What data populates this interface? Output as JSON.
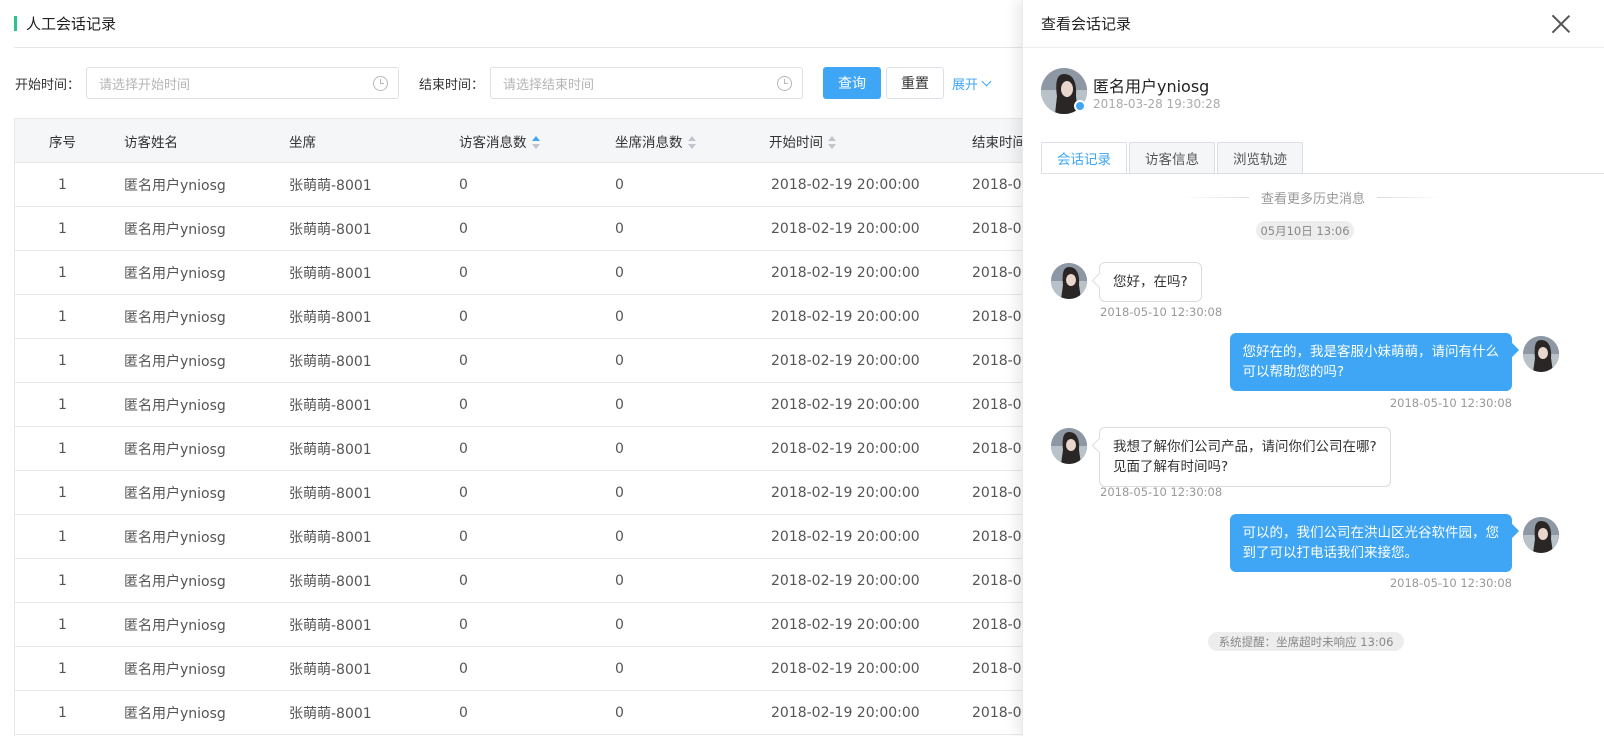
{
  "page": {
    "title": "人工会话记录",
    "filters": {
      "start_label": "开始时间：",
      "start_placeholder": "请选择开始时间",
      "end_label": "结束时间：",
      "end_placeholder": "请选择结束时间",
      "query_label": "查询",
      "reset_label": "重置",
      "expand_label": "展开"
    },
    "table": {
      "columns": [
        "序号",
        "访客姓名",
        "坐席",
        "访客消息数",
        "坐席消息数",
        "开始时间",
        "结束时间"
      ],
      "rows": [
        [
          "1",
          "匿名用户yniosg",
          "张萌萌-8001",
          "0",
          "0",
          "2018-02-19 20:00:00",
          "2018-0"
        ],
        [
          "1",
          "匿名用户yniosg",
          "张萌萌-8001",
          "0",
          "0",
          "2018-02-19 20:00:00",
          "2018-0"
        ],
        [
          "1",
          "匿名用户yniosg",
          "张萌萌-8001",
          "0",
          "0",
          "2018-02-19 20:00:00",
          "2018-0"
        ],
        [
          "1",
          "匿名用户yniosg",
          "张萌萌-8001",
          "0",
          "0",
          "2018-02-19 20:00:00",
          "2018-0"
        ],
        [
          "1",
          "匿名用户yniosg",
          "张萌萌-8001",
          "0",
          "0",
          "2018-02-19 20:00:00",
          "2018-0"
        ],
        [
          "1",
          "匿名用户yniosg",
          "张萌萌-8001",
          "0",
          "0",
          "2018-02-19 20:00:00",
          "2018-0"
        ],
        [
          "1",
          "匿名用户yniosg",
          "张萌萌-8001",
          "0",
          "0",
          "2018-02-19 20:00:00",
          "2018-0"
        ],
        [
          "1",
          "匿名用户yniosg",
          "张萌萌-8001",
          "0",
          "0",
          "2018-02-19 20:00:00",
          "2018-0"
        ],
        [
          "1",
          "匿名用户yniosg",
          "张萌萌-8001",
          "0",
          "0",
          "2018-02-19 20:00:00",
          "2018-0"
        ],
        [
          "1",
          "匿名用户yniosg",
          "张萌萌-8001",
          "0",
          "0",
          "2018-02-19 20:00:00",
          "2018-0"
        ],
        [
          "1",
          "匿名用户yniosg",
          "张萌萌-8001",
          "0",
          "0",
          "2018-02-19 20:00:00",
          "2018-0"
        ],
        [
          "1",
          "匿名用户yniosg",
          "张萌萌-8001",
          "0",
          "0",
          "2018-02-19 20:00:00",
          "2018-0"
        ],
        [
          "1",
          "匿名用户yniosg",
          "张萌萌-8001",
          "0",
          "0",
          "2018-02-19 20:00:00",
          "2018-0"
        ]
      ]
    }
  },
  "drawer": {
    "title": "查看会话记录",
    "user": {
      "name": "匿名用户yniosg",
      "time": "2018-03-28 19:30:28"
    },
    "tabs": [
      "会话记录",
      "访客信息",
      "浏览轨迹"
    ],
    "history_link": "查看更多历史消息",
    "date_divider": "05月10日 13:06",
    "messages": [
      {
        "side": "left",
        "lines": [
          "您好，在吗?"
        ],
        "time": "2018-05-10 12:30:08"
      },
      {
        "side": "right",
        "lines": [
          "您好在的，我是客服小妹萌萌，请问有什么",
          "可以帮助您的吗?"
        ],
        "time": "2018-05-10 12:30:08"
      },
      {
        "side": "left",
        "lines": [
          "我想了解你们公司产品，请问你们公司在哪?",
          "见面了解有时间吗?"
        ],
        "time": "2018-05-10 12:30:08"
      },
      {
        "side": "right",
        "lines": [
          "可以的，我们公司在洪山区光谷软件园，您",
          "到了可以打电话我们来接您。"
        ],
        "time": "2018-05-10 12:30:08"
      }
    ],
    "system_notice": "系统提醒：坐席超时未响应 13:06"
  },
  "colors": {
    "accent": "#3ea6f5",
    "title_mark": "#2bc48a"
  }
}
